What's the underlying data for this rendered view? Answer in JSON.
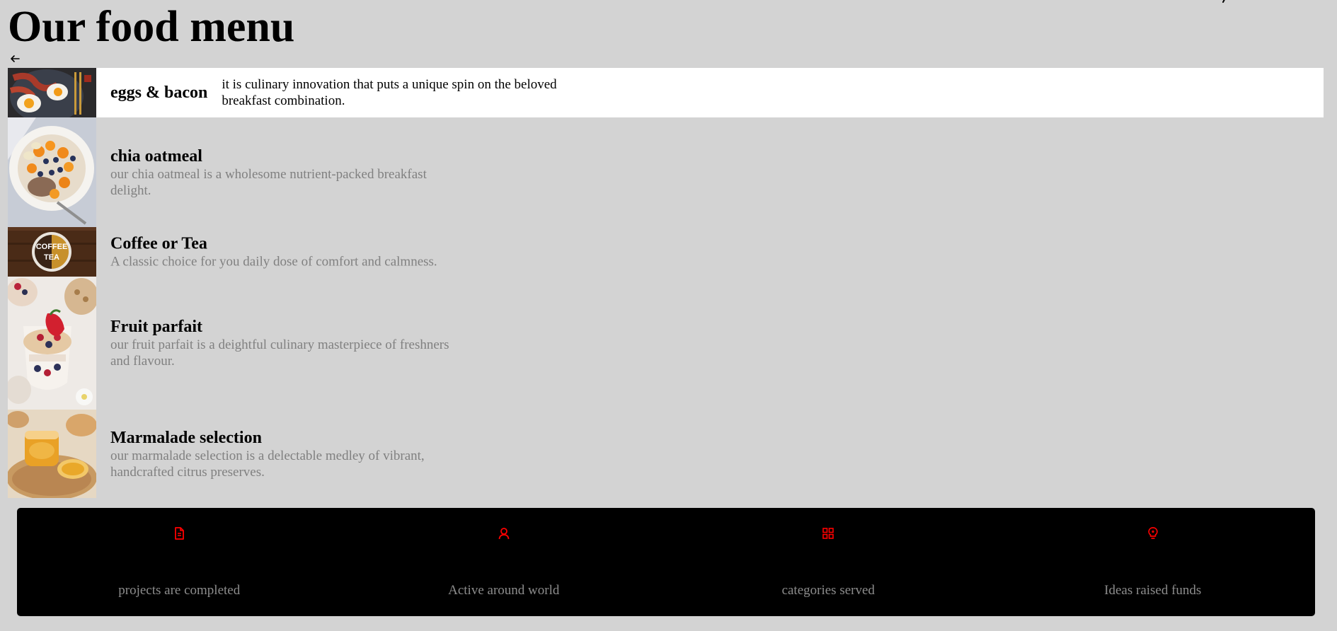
{
  "page": {
    "title": "Our food menu"
  },
  "menu": {
    "items": [
      {
        "name": "eggs & bacon",
        "description": "it is culinary innovation that puts a unique spin on the beloved breakfast combination.",
        "active": true
      },
      {
        "name": "chia oatmeal",
        "description": "our chia oatmeal is a wholesome nutrient-packed breakfast delight.",
        "active": false
      },
      {
        "name": "Coffee or Tea",
        "description": "A classic choice for you daily dose of comfort and calmness.",
        "active": false,
        "image_text": [
          "COFFEE",
          "TEA"
        ]
      },
      {
        "name": "Fruit parfait",
        "description": "our fruit parfait is a deightful culinary masterpiece of freshners and flavour.",
        "active": false
      },
      {
        "name": "Marmalade selection",
        "description": "our marmalade selection is a delectable medley of vibrant, handcrafted citrus preserves.",
        "active": false
      }
    ]
  },
  "stats": [
    {
      "icon": "document-icon",
      "label": "projects are completed"
    },
    {
      "icon": "user-icon",
      "label": "Active around world"
    },
    {
      "icon": "grid-icon",
      "label": "categories served"
    },
    {
      "icon": "lightbulb-icon",
      "label": "Ideas raised funds"
    }
  ],
  "colors": {
    "page_background": "#d3d3d3",
    "active_item_background": "#ffffff",
    "stats_background": "#000000",
    "stats_icon": "#ff0000",
    "muted_text": "#808080"
  }
}
